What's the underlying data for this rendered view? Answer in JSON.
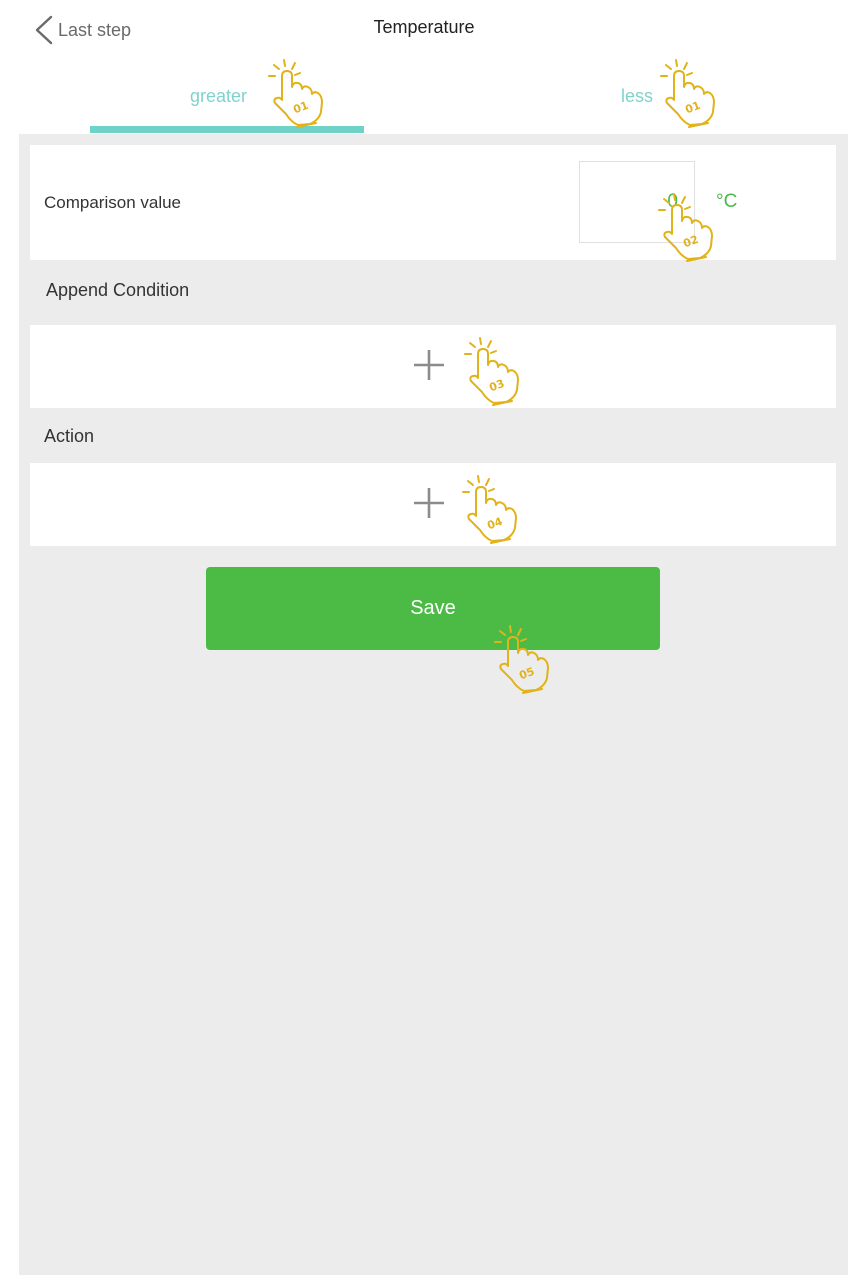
{
  "header": {
    "back_label": "Last step",
    "title": "Temperature"
  },
  "tabs": [
    {
      "label": "greater",
      "active": true
    },
    {
      "label": "less",
      "active": false
    }
  ],
  "comparison": {
    "label": "Comparison value",
    "value": "0",
    "unit": "°C"
  },
  "sections": {
    "append_condition": "Append Condition",
    "action": "Action"
  },
  "save_label": "Save",
  "pointers": [
    "01",
    "01",
    "02",
    "03",
    "04",
    "05"
  ],
  "colors": {
    "accent_teal": "#6fd2c6",
    "value_green": "#4aba4a",
    "save_green": "#4bbb45",
    "background_gray": "#ececec",
    "pointer_gold": "#e2b21b"
  }
}
